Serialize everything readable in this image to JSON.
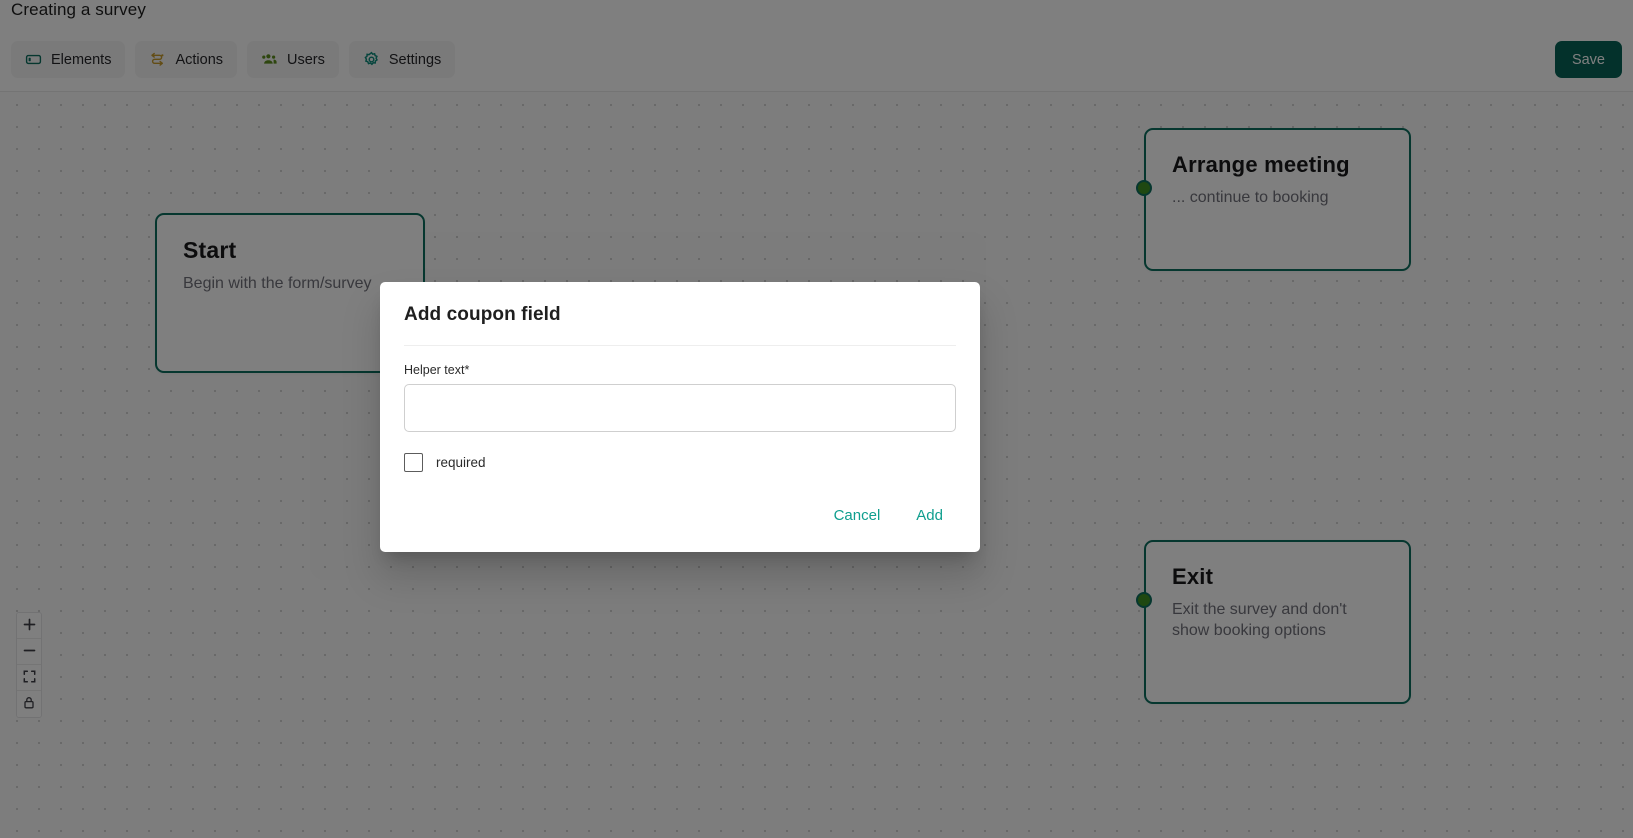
{
  "header": {
    "title": "Creating a survey",
    "tabs": [
      {
        "label": "Elements",
        "icon": "rectangle-icon",
        "color": "#0d6e5f"
      },
      {
        "label": "Actions",
        "icon": "flow-arrows-icon",
        "color": "#c79a2a"
      },
      {
        "label": "Users",
        "icon": "users-icon",
        "color": "#5c8c1e"
      },
      {
        "label": "Settings",
        "icon": "gear-icon",
        "color": "#0d8a7a"
      }
    ],
    "save_label": "Save"
  },
  "canvas": {
    "nodes": [
      {
        "id": "start",
        "title": "Start",
        "description": "Begin with the form/survey",
        "has_handle": false
      },
      {
        "id": "arrange-meeting",
        "title": "Arrange meeting",
        "description": "... continue to booking",
        "has_handle": true
      },
      {
        "id": "exit",
        "title": "Exit",
        "description": "Exit the survey and don't show booking options",
        "has_handle": true
      }
    ],
    "controls": [
      {
        "name": "zoom-in-icon",
        "glyph": "+"
      },
      {
        "name": "zoom-out-icon",
        "glyph": "−"
      },
      {
        "name": "fit-view-icon",
        "glyph": "fit"
      },
      {
        "name": "lock-icon",
        "glyph": "lock"
      }
    ],
    "node_border_color": "#0d6e5f",
    "handle_color": "#3f9023"
  },
  "modal": {
    "title": "Add coupon field",
    "helper_label": "Helper text*",
    "helper_value": "",
    "helper_placeholder": "",
    "required_label": "required",
    "required_checked": false,
    "cancel_label": "Cancel",
    "add_label": "Add",
    "accent_color": "#0f9e8e"
  }
}
